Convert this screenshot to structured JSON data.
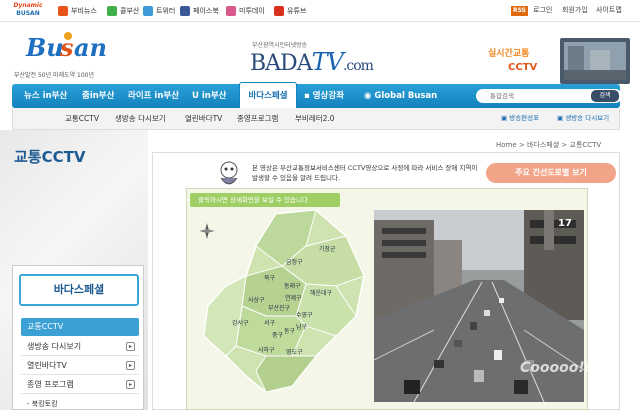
{
  "top_bar": {
    "dynamic_logo": {
      "line1": "Dynamic",
      "line2": "BUSAN"
    },
    "sns": [
      {
        "label": "부비뉴스",
        "color": "#e8541a",
        "icon": "news-icon"
      },
      {
        "label": "콜부산",
        "color": "#42b04a",
        "icon": "blog-icon"
      },
      {
        "label": "트위터",
        "color": "#3d9bd8",
        "icon": "twitter-icon"
      },
      {
        "label": "페이스북",
        "color": "#3b5998",
        "icon": "facebook-icon"
      },
      {
        "label": "미투데이",
        "color": "#d85a8c",
        "icon": "metoday-icon"
      },
      {
        "label": "유튜브",
        "color": "#d8321e",
        "icon": "youtube-icon"
      }
    ],
    "rss": "RSS",
    "links": [
      "로그인",
      "회원가입",
      "사이트맵"
    ]
  },
  "header": {
    "logo_sub": "부산발전 50년 미래도약 100년",
    "bada_sub": "부산광역시인터넷방송",
    "bada_main": "BADA",
    "bada_tv": "TV",
    "bada_com": ".com",
    "promo_line1": "실시간교통",
    "promo_line2": "CCTV"
  },
  "nav": {
    "items": [
      "뉴스 in부산",
      "줌in부산",
      "라이프 in부산",
      "U in부산"
    ],
    "active": "바다스페셜",
    "extra": "영상강좌",
    "global": "Global Busan",
    "search_placeholder": "통합검색",
    "search_button": "검색"
  },
  "subnav": {
    "items": [
      "교통CCTV",
      "생방송 다시보기",
      "열린바다TV",
      "종영프로그램",
      "부비레터2.0"
    ],
    "pills": [
      "방송편성표",
      "생방송 다시보기"
    ]
  },
  "sidebar": {
    "page_title": "교통CCTV",
    "heading": "바다스페셜",
    "items": [
      {
        "label": "교통CCTV",
        "active": true
      },
      {
        "label": "생방송 다시보기",
        "active": false
      },
      {
        "label": "열린바다TV",
        "active": false
      },
      {
        "label": "종영 프로그램",
        "active": false
      },
      {
        "label": "- 북킹토킹",
        "active": false
      }
    ]
  },
  "breadcrumb": "Home > 바다스페셜 > 교통CCTV",
  "content": {
    "intro": "본 영상은 부산교통정보서비스센터 CCTV영상으로 사정에 따라 서비스 장애 지역이 발생할 수 있음을 알려 드립니다.",
    "main_button": "주요 간선도로별 보기",
    "hint": "클릭하시면 상세화면을 보실 수 있습니다",
    "districts": [
      {
        "name": "기장군"
      },
      {
        "name": "금정구"
      },
      {
        "name": "북구"
      },
      {
        "name": "동래구"
      },
      {
        "name": "해운대구"
      },
      {
        "name": "연제구"
      },
      {
        "name": "수영구"
      },
      {
        "name": "사상구"
      },
      {
        "name": "부산진구"
      },
      {
        "name": "남구"
      },
      {
        "name": "강서구"
      },
      {
        "name": "서구"
      },
      {
        "name": "중구"
      },
      {
        "name": "동구"
      },
      {
        "name": "사하구"
      },
      {
        "name": "영도구"
      }
    ],
    "camera_number": "17",
    "watermark": "Cooooo!!!"
  }
}
